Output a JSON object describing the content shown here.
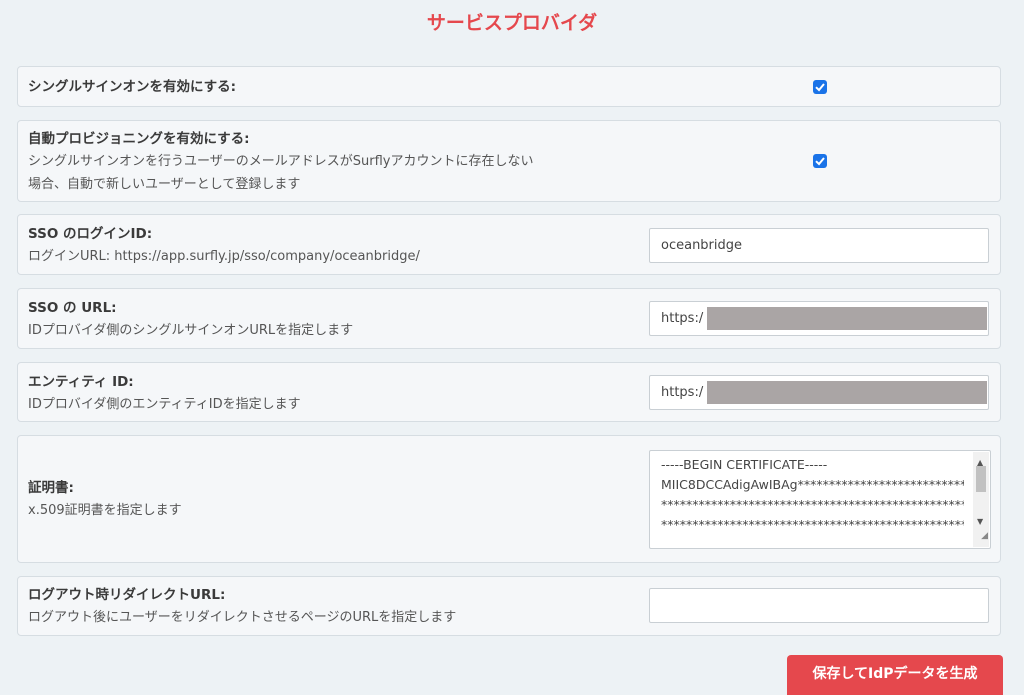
{
  "page": {
    "title": "サービスプロバイダ"
  },
  "sso_enable": {
    "label": "シングルサインオンを有効にする:",
    "checked": true
  },
  "auto_provision": {
    "label": "自動プロビジョニングを有効にする:",
    "desc_line1": "シングルサインオンを行うユーザーのメールアドレスがSurflyアカウントに存在しない",
    "desc_line2": "場合、自動で新しいユーザーとして登録します",
    "checked": true
  },
  "login_id": {
    "label": "SSO のログインID:",
    "desc": "ログインURL: https://app.surfly.jp/sso/company/oceanbridge/",
    "value": "oceanbridge"
  },
  "sso_url": {
    "label": "SSO の URL:",
    "desc": "IDプロバイダ側のシングルサインオンURLを指定します",
    "value": "https:/"
  },
  "entity_id": {
    "label": "エンティティ ID:",
    "desc": "IDプロバイダ側のエンティティIDを指定します",
    "value": "https:/"
  },
  "certificate": {
    "label": "証明書:",
    "desc": "x.509証明書を指定します",
    "lines": [
      "-----BEGIN CERTIFICATE-----",
      "MIIC8DCCAdigAwIBAg***************************",
      "***********************************************************",
      "***********************************************************"
    ]
  },
  "logout_url": {
    "label": "ログアウト時リダイレクトURL:",
    "desc": "ログアウト後にユーザーをリダイレクトさせるページのURLを指定します",
    "value": ""
  },
  "submit": {
    "label": "保存してIdPデータを生成"
  },
  "colors": {
    "accent": "#e5484d",
    "checkbox": "#1a73e8",
    "background": "#edf2f5"
  }
}
